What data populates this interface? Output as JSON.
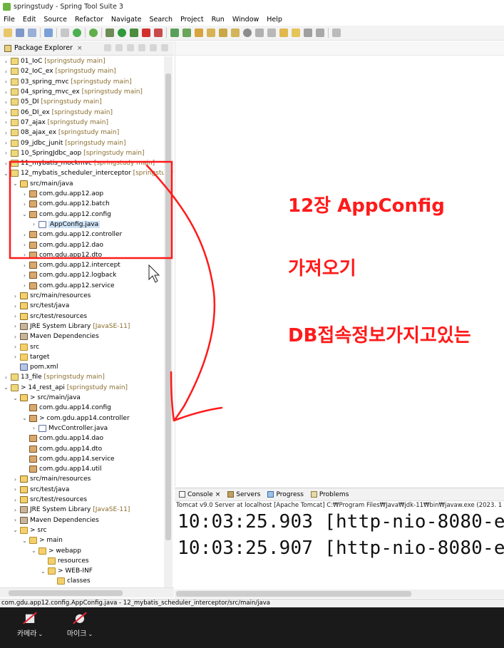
{
  "window": {
    "title": "springstudy - Spring Tool Suite 3"
  },
  "menu": [
    "File",
    "Edit",
    "Source",
    "Refactor",
    "Navigate",
    "Search",
    "Project",
    "Run",
    "Window",
    "Help"
  ],
  "explorer": {
    "title": "Package Explorer",
    "rows": [
      {
        "indent": 0,
        "arrow": ">",
        "icon": "project",
        "label": "01_IoC",
        "suffix": " [springstudy main]"
      },
      {
        "indent": 0,
        "arrow": ">",
        "icon": "project",
        "label": "02_IoC_ex",
        "suffix": " [springstudy main]"
      },
      {
        "indent": 0,
        "arrow": ">",
        "icon": "project",
        "label": "03_spring_mvc",
        "suffix": " [springstudy main]"
      },
      {
        "indent": 0,
        "arrow": ">",
        "icon": "project",
        "label": "04_spring_mvc_ex",
        "suffix": " [springstudy main]"
      },
      {
        "indent": 0,
        "arrow": ">",
        "icon": "project",
        "label": "05_DI",
        "suffix": " [springstudy main]"
      },
      {
        "indent": 0,
        "arrow": ">",
        "icon": "project",
        "label": "06_DI_ex",
        "suffix": " [springstudy main]"
      },
      {
        "indent": 0,
        "arrow": ">",
        "icon": "project",
        "label": "07_ajax",
        "suffix": " [springstudy main]"
      },
      {
        "indent": 0,
        "arrow": ">",
        "icon": "project",
        "label": "08_ajax_ex",
        "suffix": " [springstudy main]"
      },
      {
        "indent": 0,
        "arrow": ">",
        "icon": "project",
        "label": "09_jdbc_junit",
        "suffix": " [springstudy main]"
      },
      {
        "indent": 0,
        "arrow": ">",
        "icon": "project",
        "label": "10_SpringJdbc_aop",
        "suffix": " [springstudy main]"
      },
      {
        "indent": 0,
        "arrow": ">",
        "icon": "project",
        "label": "11_mybatis_mockmvc",
        "suffix": " [springstudy main]"
      },
      {
        "indent": 0,
        "arrow": "v",
        "icon": "project",
        "label": "12_mybatis_scheduler_interceptor",
        "suffix": " [springstudy"
      },
      {
        "indent": 1,
        "arrow": "v",
        "icon": "srcfolder",
        "label": "src/main/java",
        "suffix": ""
      },
      {
        "indent": 2,
        "arrow": ">",
        "icon": "package",
        "label": "com.gdu.app12.aop",
        "suffix": ""
      },
      {
        "indent": 2,
        "arrow": ">",
        "icon": "package",
        "label": "com.gdu.app12.batch",
        "suffix": ""
      },
      {
        "indent": 2,
        "arrow": "v",
        "icon": "package",
        "label": "com.gdu.app12.config",
        "suffix": ""
      },
      {
        "indent": 3,
        "arrow": ">",
        "icon": "java",
        "label": "AppConfig.java",
        "suffix": "",
        "selected": true
      },
      {
        "indent": 2,
        "arrow": ">",
        "icon": "package",
        "label": "com.gdu.app12.controller",
        "suffix": ""
      },
      {
        "indent": 2,
        "arrow": ">",
        "icon": "package",
        "label": "com.gdu.app12.dao",
        "suffix": ""
      },
      {
        "indent": 2,
        "arrow": ">",
        "icon": "package",
        "label": "com.gdu.app12.dto",
        "suffix": ""
      },
      {
        "indent": 2,
        "arrow": ">",
        "icon": "package",
        "label": "com.gdu.app12.intercept",
        "suffix": ""
      },
      {
        "indent": 2,
        "arrow": ">",
        "icon": "package",
        "label": "com.gdu.app12.logback",
        "suffix": ""
      },
      {
        "indent": 2,
        "arrow": ">",
        "icon": "package",
        "label": "com.gdu.app12.service",
        "suffix": ""
      },
      {
        "indent": 1,
        "arrow": ">",
        "icon": "srcfolder",
        "label": "src/main/resources",
        "suffix": ""
      },
      {
        "indent": 1,
        "arrow": ">",
        "icon": "srcfolder",
        "label": "src/test/java",
        "suffix": ""
      },
      {
        "indent": 1,
        "arrow": ">",
        "icon": "srcfolder",
        "label": "src/test/resources",
        "suffix": ""
      },
      {
        "indent": 1,
        "arrow": ">",
        "icon": "lib",
        "label": "JRE System Library",
        "suffix": " [JavaSE-11]"
      },
      {
        "indent": 1,
        "arrow": ">",
        "icon": "lib",
        "label": "Maven Dependencies",
        "suffix": ""
      },
      {
        "indent": 1,
        "arrow": ">",
        "icon": "folder",
        "label": "src",
        "suffix": ""
      },
      {
        "indent": 1,
        "arrow": ">",
        "icon": "folder",
        "label": "target",
        "suffix": ""
      },
      {
        "indent": 1,
        "arrow": "",
        "icon": "maven",
        "label": "pom.xml",
        "suffix": ""
      },
      {
        "indent": 0,
        "arrow": ">",
        "icon": "project",
        "label": "13_file",
        "suffix": " [springstudy main]"
      },
      {
        "indent": 0,
        "arrow": "v",
        "icon": "project",
        "label": "> 14_rest_api",
        "suffix": " [springstudy main]"
      },
      {
        "indent": 1,
        "arrow": "v",
        "icon": "srcfolder",
        "label": "> src/main/java",
        "suffix": ""
      },
      {
        "indent": 2,
        "arrow": "",
        "icon": "package",
        "label": "com.gdu.app14.config",
        "suffix": ""
      },
      {
        "indent": 2,
        "arrow": "v",
        "icon": "package",
        "label": "> com.gdu.app14.controller",
        "suffix": ""
      },
      {
        "indent": 3,
        "arrow": ">",
        "icon": "java",
        "label": "MvcController.java",
        "suffix": ""
      },
      {
        "indent": 2,
        "arrow": "",
        "icon": "package",
        "label": "com.gdu.app14.dao",
        "suffix": ""
      },
      {
        "indent": 2,
        "arrow": "",
        "icon": "package",
        "label": "com.gdu.app14.dto",
        "suffix": ""
      },
      {
        "indent": 2,
        "arrow": "",
        "icon": "package",
        "label": "com.gdu.app14.service",
        "suffix": ""
      },
      {
        "indent": 2,
        "arrow": "",
        "icon": "package",
        "label": "com.gdu.app14.util",
        "suffix": ""
      },
      {
        "indent": 1,
        "arrow": ">",
        "icon": "srcfolder",
        "label": "src/main/resources",
        "suffix": ""
      },
      {
        "indent": 1,
        "arrow": ">",
        "icon": "srcfolder",
        "label": "src/test/java",
        "suffix": ""
      },
      {
        "indent": 1,
        "arrow": ">",
        "icon": "srcfolder",
        "label": "src/test/resources",
        "suffix": ""
      },
      {
        "indent": 1,
        "arrow": ">",
        "icon": "lib",
        "label": "JRE System Library",
        "suffix": " [JavaSE-11]"
      },
      {
        "indent": 1,
        "arrow": ">",
        "icon": "lib",
        "label": "Maven Dependencies",
        "suffix": ""
      },
      {
        "indent": 1,
        "arrow": "v",
        "icon": "folder",
        "label": "> src",
        "suffix": ""
      },
      {
        "indent": 2,
        "arrow": "v",
        "icon": "folder",
        "label": "> main",
        "suffix": ""
      },
      {
        "indent": 3,
        "arrow": "v",
        "icon": "folder",
        "label": "> webapp",
        "suffix": ""
      },
      {
        "indent": 4,
        "arrow": "",
        "icon": "folder",
        "label": "resources",
        "suffix": ""
      },
      {
        "indent": 4,
        "arrow": "v",
        "icon": "folder",
        "label": "> WEB-INF",
        "suffix": ""
      },
      {
        "indent": 5,
        "arrow": "",
        "icon": "folder",
        "label": "classes",
        "suffix": ""
      }
    ]
  },
  "annotations": {
    "line1": "12장 AppConfig",
    "line2": "가져오기",
    "line3": "DB접속정보가지고있는"
  },
  "console": {
    "tabs": [
      "Console",
      "Servers",
      "Progress",
      "Problems"
    ],
    "description": "Tomcat v9.0 Server at localhost [Apache Tomcat] C:₩Program Files₩Java₩jdk-11₩bin₩javaw.exe  (2023. 1",
    "lines": [
      "10:03:25.903 [http-nio-8080-e",
      "10:03:25.907 [http-nio-8080-e"
    ]
  },
  "status": {
    "text": "com.gdu.app12.config.AppConfig.java - 12_mybatis_scheduler_interceptor/src/main/java"
  },
  "meeting": {
    "camera_label": "카메라",
    "mic_label": "마이크"
  },
  "colors": {
    "annotation": "#ff1a1a",
    "meeting_bar": "#1a1a1a"
  }
}
